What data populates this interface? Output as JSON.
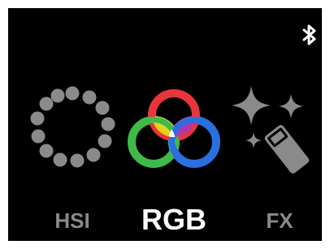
{
  "status_bar": {
    "bluetooth_icon": "bluetooth-icon"
  },
  "modes": [
    {
      "label": "HSI",
      "icon": "dots-ring-icon",
      "selected": false
    },
    {
      "label": "RGB",
      "icon": "rgb-circles-icon",
      "selected": true
    },
    {
      "label": "FX",
      "icon": "magic-wand-sparkles-icon",
      "selected": false
    }
  ],
  "colors": {
    "background": "#000000",
    "selected_label": "#ffffff",
    "unselected": "#8a8a8a",
    "red": "#e8353b",
    "green": "#3fba4a",
    "blue": "#2a6fe0",
    "yellow": "#e8d81c",
    "magenta": "#b03aa8",
    "cyan": "#25b7cf"
  }
}
